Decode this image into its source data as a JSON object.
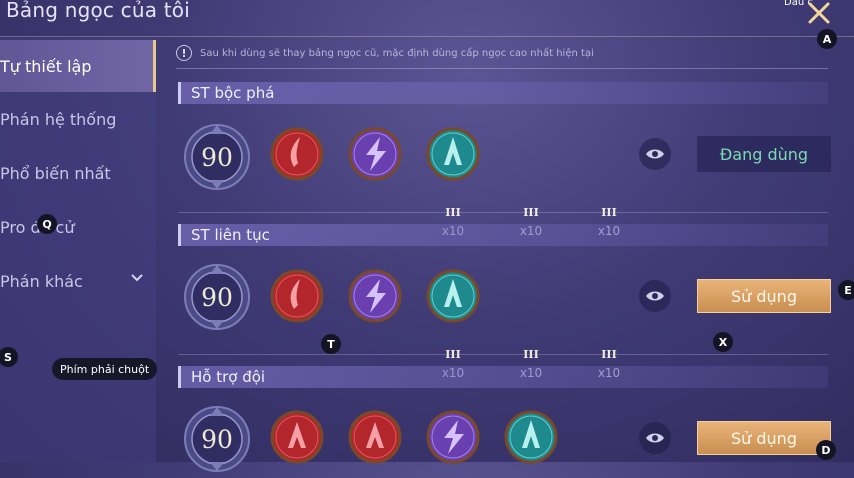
{
  "header": {
    "title": "Bảng ngọc của tôi",
    "corner_label": "Dấu c"
  },
  "sidebar": {
    "items": [
      {
        "label": "Tự thiết lập",
        "active": true
      },
      {
        "label": "Phán hệ thống"
      },
      {
        "label": "Phổ biến nhất"
      },
      {
        "label": "Pro đề cử"
      },
      {
        "label": "Phán khác",
        "has_chevron": true
      }
    ]
  },
  "notice": "Sau khi dùng sẽ thay bảng ngọc cũ, mặc định dùng cấp ngọc cao nhất hiện tại",
  "sets": [
    {
      "name": "ST bộc phá",
      "level": "90",
      "gems": [
        {
          "color": "red",
          "icon": "blade-icon",
          "rank": "III",
          "count": "x10"
        },
        {
          "color": "purple",
          "icon": "lightning-icon",
          "rank": "III",
          "count": "x10"
        },
        {
          "color": "teal",
          "icon": "tower-icon",
          "rank": "III",
          "count": "x10"
        }
      ],
      "button": "Đang dùng",
      "button_state": "in-use"
    },
    {
      "name": "ST liên tục",
      "level": "90",
      "gems": [
        {
          "color": "red",
          "icon": "blade-icon",
          "rank": "III",
          "count": "x10"
        },
        {
          "color": "purple",
          "icon": "lightning-icon",
          "rank": "III",
          "count": "x10"
        },
        {
          "color": "teal",
          "icon": "tower-icon",
          "rank": "III",
          "count": "x10"
        }
      ],
      "button": "Sử dụng",
      "button_state": "use"
    },
    {
      "name": "Hỗ trợ đội",
      "level": "90",
      "gems": [
        {
          "color": "red",
          "icon": "tower-icon"
        },
        {
          "color": "red",
          "icon": "tower-icon"
        },
        {
          "color": "purple",
          "icon": "lightning-icon"
        },
        {
          "color": "teal",
          "icon": "tower-icon"
        }
      ],
      "button": "Sử dụng",
      "button_state": "use"
    }
  ],
  "hotkeys": {
    "a": "A",
    "e": "E",
    "q": "Q",
    "s": "S",
    "t": "T",
    "x": "X",
    "d": "D",
    "right_click_hint": "Phím phải chuột"
  },
  "colors": {
    "accent_gold": "#e8c98a",
    "in_use_text": "#7ddab0",
    "use_button": "#d9a066",
    "gem_red": "#b3262c",
    "gem_purple": "#6a3fb0",
    "gem_teal": "#1f8a8e"
  }
}
